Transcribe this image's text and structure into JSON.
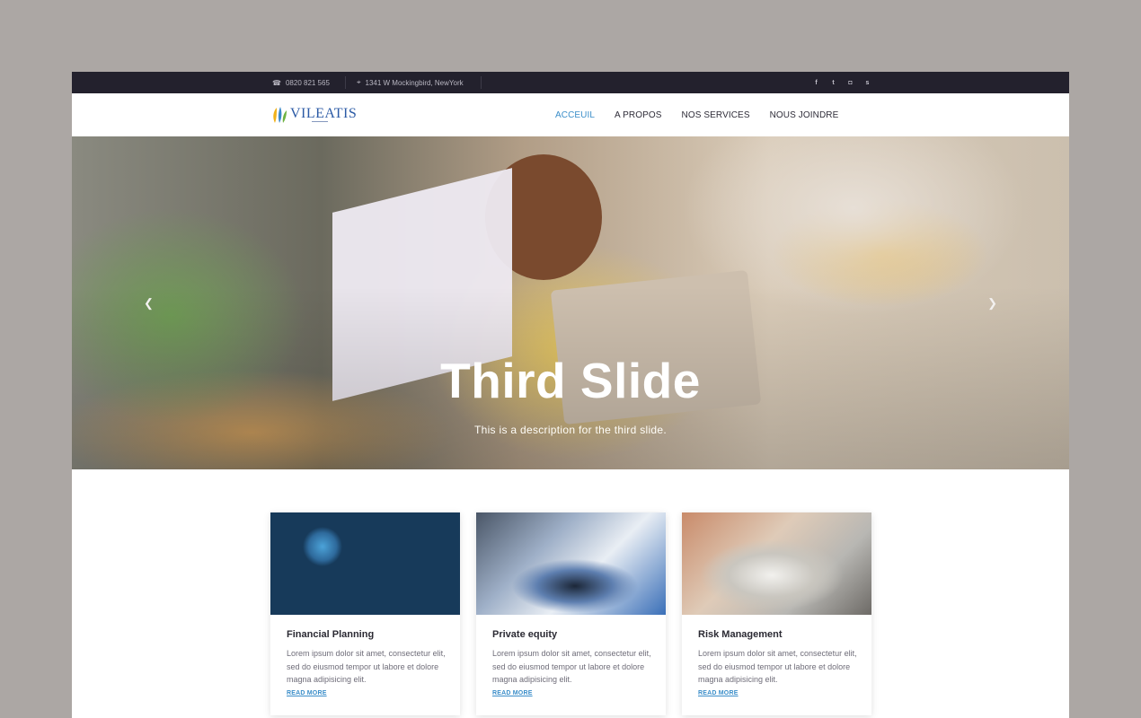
{
  "topbar": {
    "phone": "0820 821 565",
    "address": "1341 W Mockingbird, NewYork",
    "social": [
      {
        "icon": "facebook-icon",
        "glyph": "f"
      },
      {
        "icon": "twitter-icon",
        "glyph": "t"
      },
      {
        "icon": "instagram-icon",
        "glyph": "◘"
      },
      {
        "icon": "skype-icon",
        "glyph": "s"
      }
    ]
  },
  "header": {
    "logo_text": "VILEATIS",
    "nav": [
      {
        "label": "ACCEUIL",
        "active": true
      },
      {
        "label": "A PROPOS",
        "active": false
      },
      {
        "label": "NOS SERVICES",
        "active": false
      },
      {
        "label": "NOUS JOINDRE",
        "active": false
      }
    ]
  },
  "hero": {
    "title": "Third Slide",
    "description": "This is a description for the third slide."
  },
  "cards": [
    {
      "title": "Financial Planning",
      "text": "Lorem ipsum dolor sit amet, consectetur elit, sed do eiusmod tempor ut labore et dolore magna adipisicing elit.",
      "link": "READ MORE"
    },
    {
      "title": "Private equity",
      "text": "Lorem ipsum dolor sit amet, consectetur elit, sed do eiusmod tempor ut labore et dolore magna adipisicing elit.",
      "link": "READ MORE"
    },
    {
      "title": "Risk Management",
      "text": "Lorem ipsum dolor sit amet, consectetur elit, sed do eiusmod tempor ut labore et dolore magna adipisicing elit.",
      "link": "READ MORE"
    }
  ],
  "colors": {
    "topbar_bg": "#23212d",
    "accent": "#3b8ec9",
    "page_bg": "#aca7a4"
  }
}
